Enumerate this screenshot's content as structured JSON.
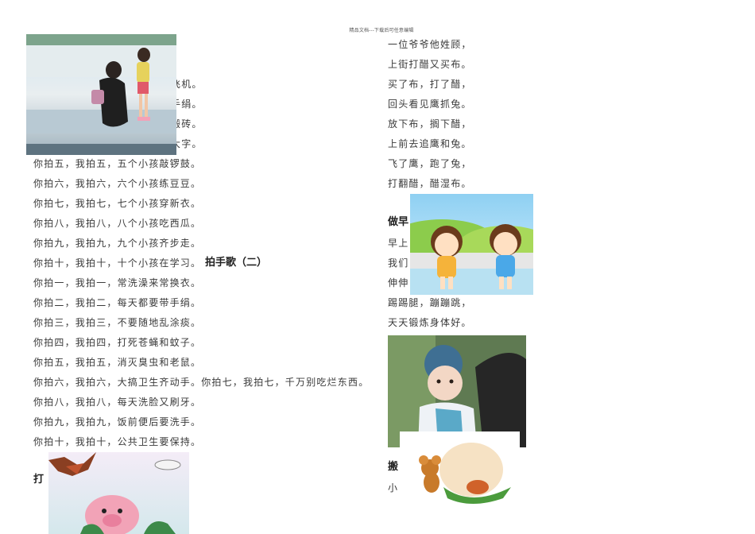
{
  "header": "精品文档---下载后可任意编辑",
  "left": {
    "partial_lines": [
      "飞机。",
      "手绢。",
      "搬砖。",
      "大字。"
    ],
    "lines": [
      "你拍五，我拍五，五个小孩敲锣鼓。",
      "你拍六，我拍六，六个小孩练豆豆。",
      "你拍七，我拍七，七个小孩穿新衣。",
      "你拍八，我拍八，八个小孩吃西瓜。",
      "你拍九，我拍九，九个小孩齐步走。",
      "你拍十，我拍十，十个小孩在学习。",
      "你拍一，我拍一，常洗澡来常换衣。",
      "你拍二，我拍二，每天都要带手绢。",
      "你拍三，我拍三，不要随地乱涂痰。",
      "你拍四，我拍四，打死苍蝇和蚊子。",
      "你拍五，我拍五，消灭臭虫和老鼠。",
      "你拍六，我拍六，大搞卫生齐动手。你拍七，我拍七，千万别吃烂东西。",
      "你拍八，我拍八，每天洗脸又刷牙。",
      "你拍九，我拍九，饭前便后要洗手。",
      "你拍十，我拍十，公共卫生要保持。"
    ],
    "heading_song2": "拍手歌（二）",
    "heading_partial": "打"
  },
  "right": {
    "lines_top": [
      "一位爷爷他姓顾，",
      "上街打醋又买布。",
      "买了布，打了醋，",
      "回头看见鹰抓兔。",
      "放下布，搁下醋，",
      "上前去追鹰和兔。",
      "飞了鹰，跑了兔，",
      "打翻醋，醋湿布。"
    ],
    "heading_partial": "做早",
    "lines_mid": [
      "早上",
      "我们",
      "伸伸",
      "踢踢腿，蹦蹦跳，",
      "天天锻炼身体好。"
    ],
    "heading_partial2": "搬",
    "line_bottom": "小"
  },
  "images": {
    "mother_child_photo": "mother and girl clapping hands photo",
    "cartoon_kids": "two cartoon children waving",
    "baby_photo": "baby in blue hat on bench",
    "mouse_egg": "cartoon mouse pushing egg",
    "eagle_pig": "cartoon eagle and pig illustration"
  }
}
